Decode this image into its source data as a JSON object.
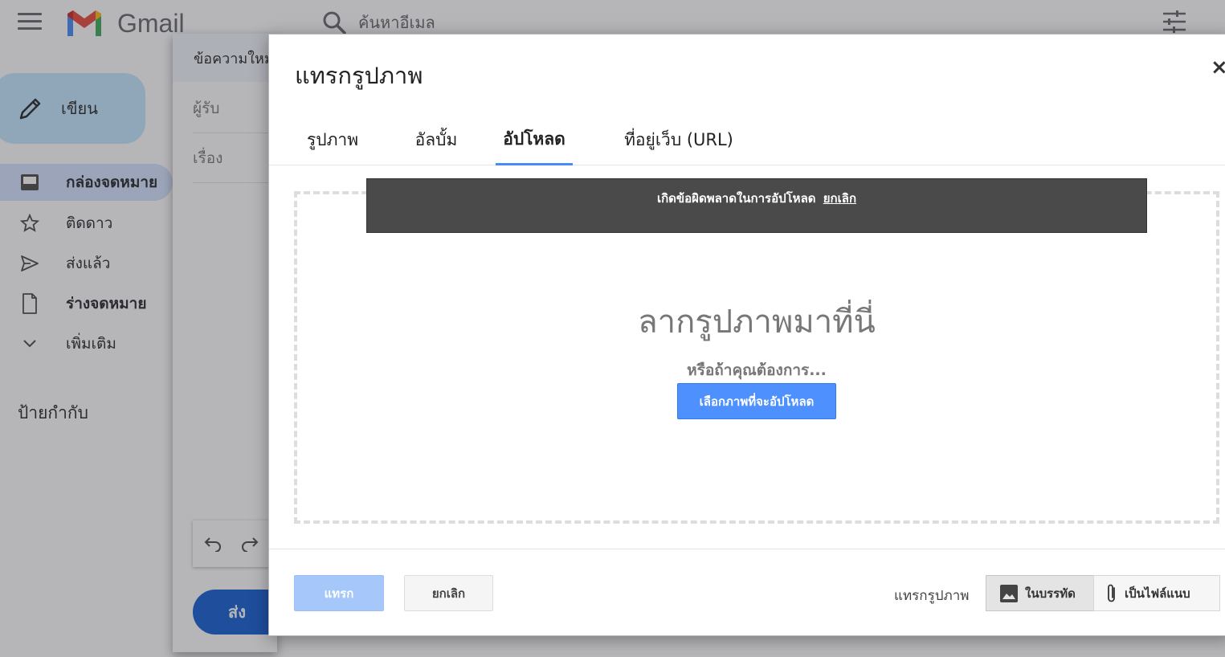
{
  "gmail": {
    "logo_text": "Gmail",
    "search_placeholder": "ค้นหาอีเมล",
    "compose_label": "เขียน",
    "nav": [
      {
        "label": "กล่องจดหมาย",
        "icon": "inbox-icon"
      },
      {
        "label": "ติดดาว",
        "icon": "star-icon"
      },
      {
        "label": "ส่งแล้ว",
        "icon": "send-icon"
      },
      {
        "label": "ร่างจดหมาย",
        "icon": "draft-icon"
      },
      {
        "label": "เพิ่มเติม",
        "icon": "chevron-down-icon"
      }
    ],
    "labels_title": "ป้ายกำกับ",
    "compose_window": {
      "title": "ข้อความใหม่",
      "to_placeholder": "ผู้รับ",
      "subject_placeholder": "เรื่อง",
      "send_label": "ส่ง"
    }
  },
  "dialog": {
    "title": "แทรกรูปภาพ",
    "close": "×",
    "tabs": [
      {
        "label": "รูปภาพ",
        "active": false
      },
      {
        "label": "อัลบั้ม",
        "active": false
      },
      {
        "label": "อัปโหลด",
        "active": true
      },
      {
        "label": "ที่อยู่เว็บ (URL)",
        "active": false
      }
    ],
    "error_message": "เกิดข้อผิดพลาดในการอัปโหลด",
    "error_cancel": "ยกเลิก",
    "drag_text": "ลากรูปภาพมาที่นี่",
    "or_text": "หรือถ้าคุณต้องการ...",
    "choose_button": "เลือกภาพที่จะอัปโหลด",
    "footer": {
      "insert_button": "แทรก",
      "cancel_button": "ยกเลิก",
      "insert_mode_label": "แทรกรูปภาพ",
      "inline_option": "ในบรรทัด",
      "attachment_option": "เป็นไฟล์แนบ",
      "selected_mode": "ในบรรทัด"
    }
  },
  "colors": {
    "accent": "#4d90fe",
    "active_tab_underline": "#4a8af4",
    "error_bg": "#4a4a4a"
  }
}
